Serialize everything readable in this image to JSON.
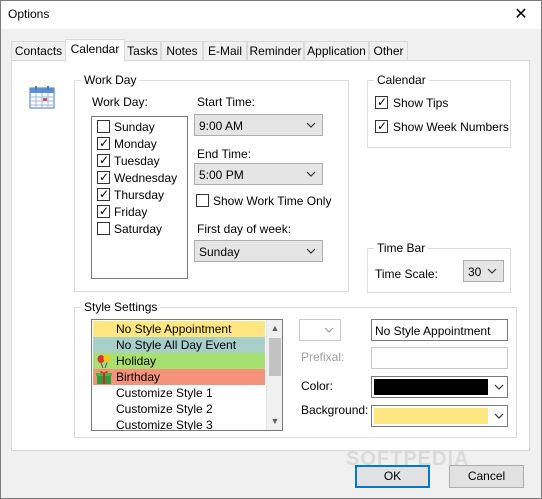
{
  "window": {
    "title": "Options"
  },
  "tabs": [
    "Contacts",
    "Calendar",
    "Tasks",
    "Notes",
    "E-Mail",
    "Reminder",
    "Application",
    "Other"
  ],
  "work_day": {
    "group_label": "Work Day",
    "days_label": "Work Day:",
    "days": [
      {
        "label": "Sunday",
        "checked": false
      },
      {
        "label": "Monday",
        "checked": true
      },
      {
        "label": "Tuesday",
        "checked": true
      },
      {
        "label": "Wednesday",
        "checked": true
      },
      {
        "label": "Thursday",
        "checked": true
      },
      {
        "label": "Friday",
        "checked": true
      },
      {
        "label": "Saturday",
        "checked": false
      }
    ],
    "start_time_label": "Start Time:",
    "start_time": "9:00 AM",
    "end_time_label": "End Time:",
    "end_time": "5:00 PM",
    "show_work_time_only": "Show Work Time Only",
    "first_day_label": "First day of week:",
    "first_day": "Sunday"
  },
  "calendar": {
    "group_label": "Calendar",
    "show_tips": "Show Tips",
    "show_week_numbers": "Show Week Numbers"
  },
  "time_bar": {
    "group_label": "Time Bar",
    "scale_label": "Time Scale:",
    "scale": "30"
  },
  "style_settings": {
    "group_label": "Style Settings",
    "items": [
      {
        "label": "No Style Appointment",
        "bg": "#ffe680",
        "icon": ""
      },
      {
        "label": "No Style All Day Event",
        "bg": "#a8cfc8",
        "icon": ""
      },
      {
        "label": "Holiday",
        "bg": "#a6e06e",
        "icon": "balloons-icon"
      },
      {
        "label": "Birthday",
        "bg": "#f5937a",
        "icon": "gift-icon"
      },
      {
        "label": "Customize Style 1",
        "bg": "",
        "icon": ""
      },
      {
        "label": "Customize Style 2",
        "bg": "",
        "icon": ""
      },
      {
        "label": "Customize Style 3",
        "bg": "",
        "icon": ""
      }
    ],
    "name_value": "No Style Appointment",
    "prefixal_label": "Prefixal:",
    "prefixal_value": "",
    "color_label": "Color:",
    "color_value": "#000000",
    "background_label": "Background:",
    "background_value": "#ffe680"
  },
  "buttons": {
    "ok": "OK",
    "cancel": "Cancel"
  },
  "watermark": "SOFTPEDIA"
}
